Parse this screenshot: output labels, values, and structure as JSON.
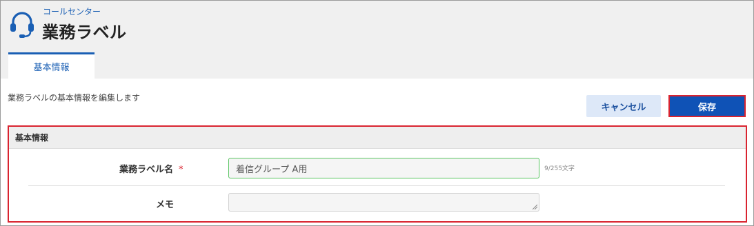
{
  "header": {
    "breadcrumb": "コールセンター",
    "title": "業務ラベル",
    "icon": "headset-icon",
    "accent_color": "#1a5fb4"
  },
  "tabs": [
    {
      "label": "基本情報",
      "active": true
    }
  ],
  "description": "業務ラベルの基本情報を編集します",
  "actions": {
    "cancel_label": "キャンセル",
    "save_label": "保存"
  },
  "section": {
    "title": "基本情報",
    "fields": {
      "name": {
        "label": "業務ラベル名",
        "required_mark": "*",
        "value": "着信グループ A用",
        "counter": "9/255文字"
      },
      "memo": {
        "label": "メモ",
        "value": ""
      }
    }
  },
  "colors": {
    "primary": "#0f52b6",
    "highlight_border": "#d9232f",
    "valid_border": "#55c35e"
  }
}
